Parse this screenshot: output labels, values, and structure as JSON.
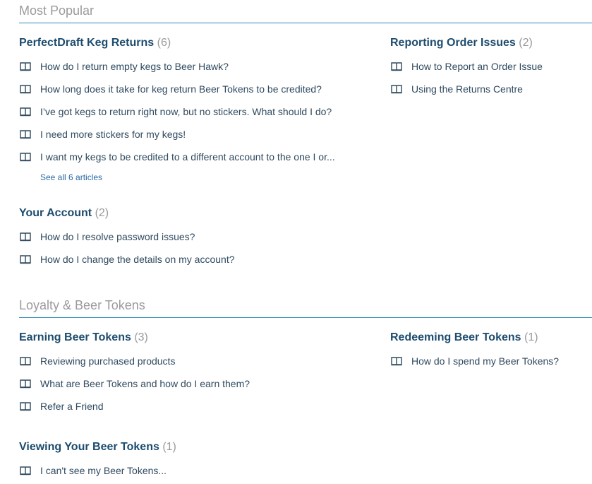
{
  "sections": [
    {
      "title": "Most Popular",
      "categories": [
        {
          "name": "PerfectDraft Keg Returns",
          "count": "(6)",
          "articles": [
            "How do I return empty kegs to Beer Hawk?",
            "How long does it take for keg return Beer Tokens to be credited?",
            "I’ve got kegs to return right now, but no stickers. What should I do?",
            "I need more stickers for my kegs!",
            "I want my kegs to be credited to a different account to the one I or..."
          ],
          "see_all": "See all 6 articles"
        },
        {
          "name": "Reporting Order Issues",
          "count": "(2)",
          "articles": [
            "How to Report an Order Issue",
            "Using the Returns Centre"
          ]
        },
        {
          "name": "Your Account",
          "count": "(2)",
          "articles": [
            "How do I resolve password issues?",
            "How do I change the details on my account?"
          ]
        }
      ]
    },
    {
      "title": "Loyalty & Beer Tokens",
      "categories": [
        {
          "name": "Earning Beer Tokens",
          "count": "(3)",
          "articles": [
            "Reviewing purchased products",
            "What are Beer Tokens and how do I earn them?",
            "Refer a Friend"
          ]
        },
        {
          "name": "Redeeming Beer Tokens",
          "count": "(1)",
          "articles": [
            "How do I spend my Beer Tokens?"
          ]
        },
        {
          "name": "Viewing Your Beer Tokens",
          "count": "(1)",
          "articles": [
            "I can't see my Beer Tokens..."
          ]
        }
      ]
    }
  ],
  "icons": {
    "article": "book-icon",
    "color": "#2f4a5f"
  }
}
